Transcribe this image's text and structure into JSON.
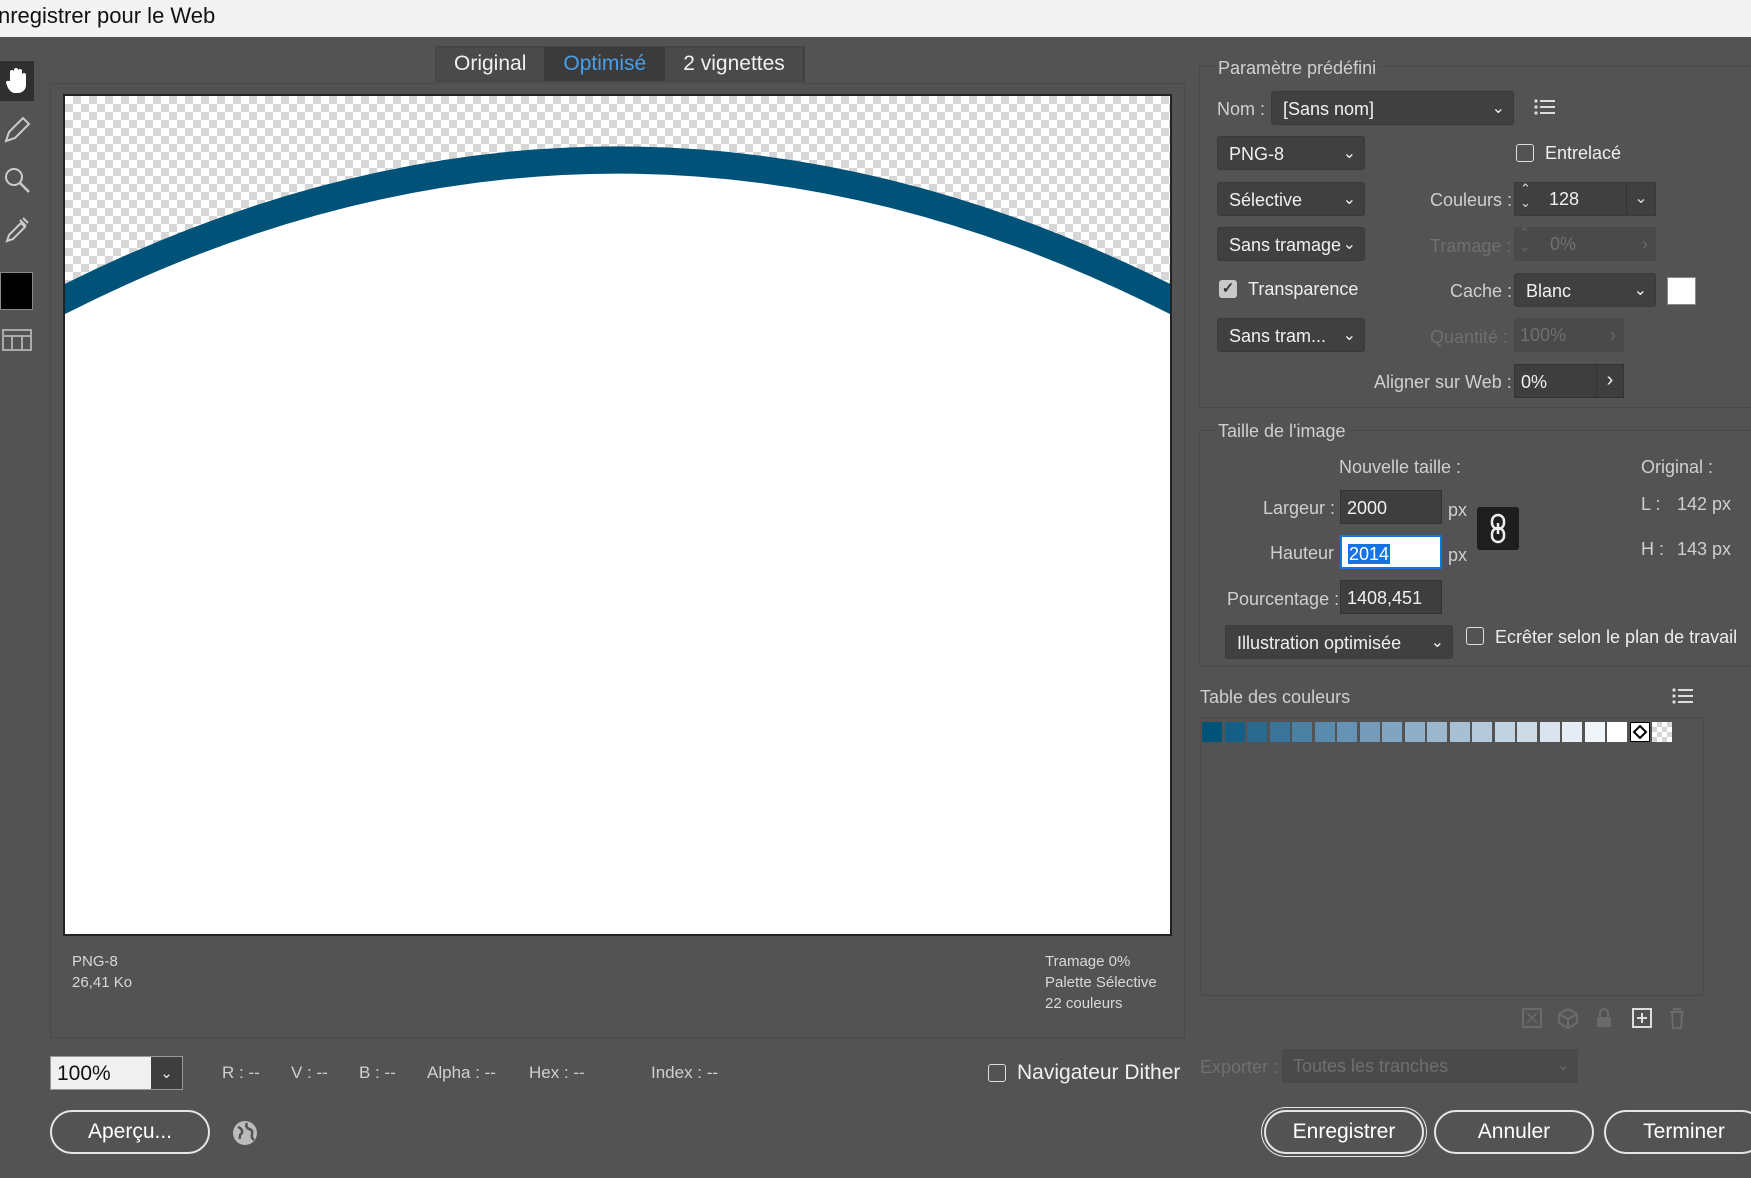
{
  "window": {
    "title": "nregistrer pour le Web"
  },
  "tabs": [
    "Original",
    "Optimisé",
    "2 vignettes"
  ],
  "preview_info": {
    "format": "PNG-8",
    "size": "26,41 Ko",
    "dither": "Tramage 0%",
    "palette": "Palette Sélective",
    "colors": "22 couleurs"
  },
  "bottom": {
    "zoom": "100%",
    "r": "R : --",
    "v": "V : --",
    "b": "B : --",
    "alpha": "Alpha : --",
    "hex": "Hex : --",
    "index": "Index : --",
    "navigator": "Navigateur Dither",
    "preview_button": "Aperçu...",
    "save_button": "Enregistrer",
    "cancel_button": "Annuler",
    "done_button": "Terminer"
  },
  "preset": {
    "section_title": "Paramètre prédéfini",
    "name_label": "Nom :",
    "name_value": "[Sans nom]",
    "format": "PNG-8",
    "interlaced": "Entrelacé",
    "reduction": "Sélective",
    "colors_label": "Couleurs :",
    "colors_value": "128",
    "dither_algo": "Sans tramage",
    "dither_label": "Tramage :",
    "dither_value": "0%",
    "transparency": "Transparence",
    "matte_label": "Cache :",
    "matte_value": "Blanc",
    "transparency_dither": "Sans tram...",
    "amount_label": "Quantité :",
    "amount_value": "100%",
    "websnap_label": "Aligner sur Web :",
    "websnap_value": "0%"
  },
  "image_size": {
    "section_title": "Taille de l'image",
    "new_size_label": "Nouvelle taille :",
    "original_label": "Original :",
    "width_label": "Largeur :",
    "width_value": "2000",
    "height_label": "Hauteur :",
    "height_value": "2014",
    "unit": "px",
    "percent_label": "Pourcentage :",
    "percent_value": "1408,451",
    "orig_w_label": "L :",
    "orig_w_value": "142 px",
    "orig_h_label": "H :",
    "orig_h_value": "143 px",
    "quality": "Illustration optimisée",
    "clip": "Ecrêter selon le plan de travail"
  },
  "color_table": {
    "title": "Table des couleurs",
    "swatches": [
      "#005279",
      "#155f86",
      "#2a6a8f",
      "#3a7599",
      "#4a80a2",
      "#5a8aac",
      "#6693b3",
      "#749cba",
      "#81a5c1",
      "#8faec8",
      "#9bb7ce",
      "#a8c0d4",
      "#b5c9db",
      "#c1d2e1",
      "#cddbe7",
      "#d9e4ee",
      "#e5ecf3",
      "#f0f5f9",
      "#ffffff"
    ]
  },
  "export": {
    "label": "Exporter :",
    "value": "Toutes les tranches"
  },
  "colors": {
    "arc": "#005279",
    "accent": "#4a9fe8"
  }
}
